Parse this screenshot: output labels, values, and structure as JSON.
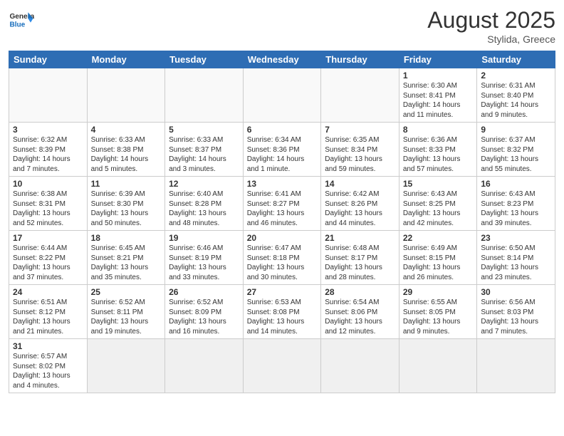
{
  "header": {
    "logo_general": "General",
    "logo_blue": "Blue",
    "month_title": "August 2025",
    "subtitle": "Stylida, Greece"
  },
  "days_of_week": [
    "Sunday",
    "Monday",
    "Tuesday",
    "Wednesday",
    "Thursday",
    "Friday",
    "Saturday"
  ],
  "weeks": [
    [
      {
        "num": "",
        "info": ""
      },
      {
        "num": "",
        "info": ""
      },
      {
        "num": "",
        "info": ""
      },
      {
        "num": "",
        "info": ""
      },
      {
        "num": "",
        "info": ""
      },
      {
        "num": "1",
        "info": "Sunrise: 6:30 AM\nSunset: 8:41 PM\nDaylight: 14 hours and 11 minutes."
      },
      {
        "num": "2",
        "info": "Sunrise: 6:31 AM\nSunset: 8:40 PM\nDaylight: 14 hours and 9 minutes."
      }
    ],
    [
      {
        "num": "3",
        "info": "Sunrise: 6:32 AM\nSunset: 8:39 PM\nDaylight: 14 hours and 7 minutes."
      },
      {
        "num": "4",
        "info": "Sunrise: 6:33 AM\nSunset: 8:38 PM\nDaylight: 14 hours and 5 minutes."
      },
      {
        "num": "5",
        "info": "Sunrise: 6:33 AM\nSunset: 8:37 PM\nDaylight: 14 hours and 3 minutes."
      },
      {
        "num": "6",
        "info": "Sunrise: 6:34 AM\nSunset: 8:36 PM\nDaylight: 14 hours and 1 minute."
      },
      {
        "num": "7",
        "info": "Sunrise: 6:35 AM\nSunset: 8:34 PM\nDaylight: 13 hours and 59 minutes."
      },
      {
        "num": "8",
        "info": "Sunrise: 6:36 AM\nSunset: 8:33 PM\nDaylight: 13 hours and 57 minutes."
      },
      {
        "num": "9",
        "info": "Sunrise: 6:37 AM\nSunset: 8:32 PM\nDaylight: 13 hours and 55 minutes."
      }
    ],
    [
      {
        "num": "10",
        "info": "Sunrise: 6:38 AM\nSunset: 8:31 PM\nDaylight: 13 hours and 52 minutes."
      },
      {
        "num": "11",
        "info": "Sunrise: 6:39 AM\nSunset: 8:30 PM\nDaylight: 13 hours and 50 minutes."
      },
      {
        "num": "12",
        "info": "Sunrise: 6:40 AM\nSunset: 8:28 PM\nDaylight: 13 hours and 48 minutes."
      },
      {
        "num": "13",
        "info": "Sunrise: 6:41 AM\nSunset: 8:27 PM\nDaylight: 13 hours and 46 minutes."
      },
      {
        "num": "14",
        "info": "Sunrise: 6:42 AM\nSunset: 8:26 PM\nDaylight: 13 hours and 44 minutes."
      },
      {
        "num": "15",
        "info": "Sunrise: 6:43 AM\nSunset: 8:25 PM\nDaylight: 13 hours and 42 minutes."
      },
      {
        "num": "16",
        "info": "Sunrise: 6:43 AM\nSunset: 8:23 PM\nDaylight: 13 hours and 39 minutes."
      }
    ],
    [
      {
        "num": "17",
        "info": "Sunrise: 6:44 AM\nSunset: 8:22 PM\nDaylight: 13 hours and 37 minutes."
      },
      {
        "num": "18",
        "info": "Sunrise: 6:45 AM\nSunset: 8:21 PM\nDaylight: 13 hours and 35 minutes."
      },
      {
        "num": "19",
        "info": "Sunrise: 6:46 AM\nSunset: 8:19 PM\nDaylight: 13 hours and 33 minutes."
      },
      {
        "num": "20",
        "info": "Sunrise: 6:47 AM\nSunset: 8:18 PM\nDaylight: 13 hours and 30 minutes."
      },
      {
        "num": "21",
        "info": "Sunrise: 6:48 AM\nSunset: 8:17 PM\nDaylight: 13 hours and 28 minutes."
      },
      {
        "num": "22",
        "info": "Sunrise: 6:49 AM\nSunset: 8:15 PM\nDaylight: 13 hours and 26 minutes."
      },
      {
        "num": "23",
        "info": "Sunrise: 6:50 AM\nSunset: 8:14 PM\nDaylight: 13 hours and 23 minutes."
      }
    ],
    [
      {
        "num": "24",
        "info": "Sunrise: 6:51 AM\nSunset: 8:12 PM\nDaylight: 13 hours and 21 minutes."
      },
      {
        "num": "25",
        "info": "Sunrise: 6:52 AM\nSunset: 8:11 PM\nDaylight: 13 hours and 19 minutes."
      },
      {
        "num": "26",
        "info": "Sunrise: 6:52 AM\nSunset: 8:09 PM\nDaylight: 13 hours and 16 minutes."
      },
      {
        "num": "27",
        "info": "Sunrise: 6:53 AM\nSunset: 8:08 PM\nDaylight: 13 hours and 14 minutes."
      },
      {
        "num": "28",
        "info": "Sunrise: 6:54 AM\nSunset: 8:06 PM\nDaylight: 13 hours and 12 minutes."
      },
      {
        "num": "29",
        "info": "Sunrise: 6:55 AM\nSunset: 8:05 PM\nDaylight: 13 hours and 9 minutes."
      },
      {
        "num": "30",
        "info": "Sunrise: 6:56 AM\nSunset: 8:03 PM\nDaylight: 13 hours and 7 minutes."
      }
    ],
    [
      {
        "num": "31",
        "info": "Sunrise: 6:57 AM\nSunset: 8:02 PM\nDaylight: 13 hours and 4 minutes."
      },
      {
        "num": "",
        "info": ""
      },
      {
        "num": "",
        "info": ""
      },
      {
        "num": "",
        "info": ""
      },
      {
        "num": "",
        "info": ""
      },
      {
        "num": "",
        "info": ""
      },
      {
        "num": "",
        "info": ""
      }
    ]
  ]
}
